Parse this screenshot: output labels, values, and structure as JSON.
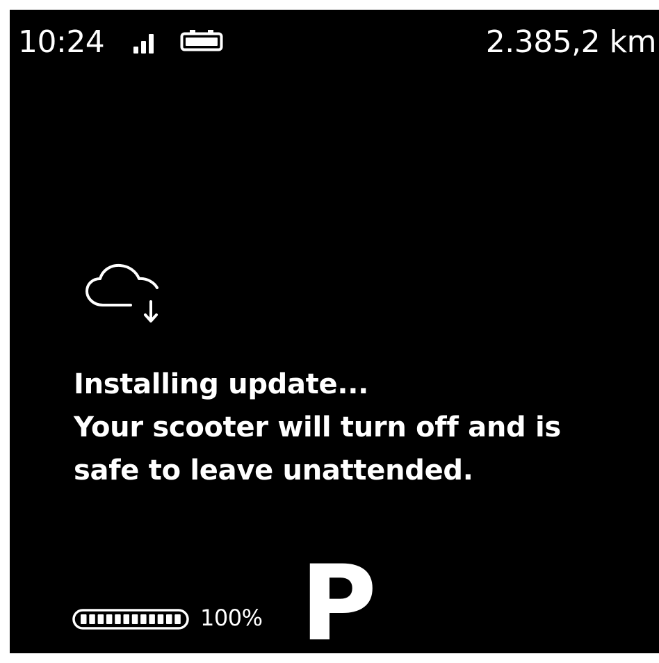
{
  "status_bar": {
    "time": "10:24",
    "signal_icon": "cellular-signal-icon",
    "battery_icon": "battery-icon",
    "odometer": "2.385,2 km"
  },
  "update": {
    "icon": "cloud-download-icon",
    "title": "Installing update...",
    "line2": "Your scooter will turn off and is",
    "line3": "safe to leave unattended."
  },
  "footer": {
    "battery_level": 1.0,
    "battery_percent": "100%",
    "gear": "P"
  },
  "colors": {
    "background": "#000000",
    "foreground": "#ffffff"
  }
}
